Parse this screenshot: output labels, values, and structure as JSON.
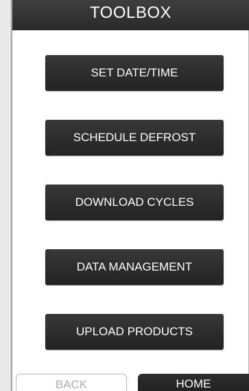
{
  "header": {
    "title": "TOOLBOX"
  },
  "menu": {
    "items": [
      {
        "label": "SET DATE/TIME"
      },
      {
        "label": "SCHEDULE DEFROST"
      },
      {
        "label": "DOWNLOAD CYCLES"
      },
      {
        "label": "DATA MANAGEMENT"
      },
      {
        "label": "UPLOAD PRODUCTS"
      }
    ]
  },
  "footer": {
    "back_label": "BACK",
    "home_label": "HOME"
  },
  "colors": {
    "button_background": "#2e2e2e",
    "button_text": "#ffffff",
    "disabled_text": "#b0b0b0",
    "page_background": "#ffffff"
  }
}
